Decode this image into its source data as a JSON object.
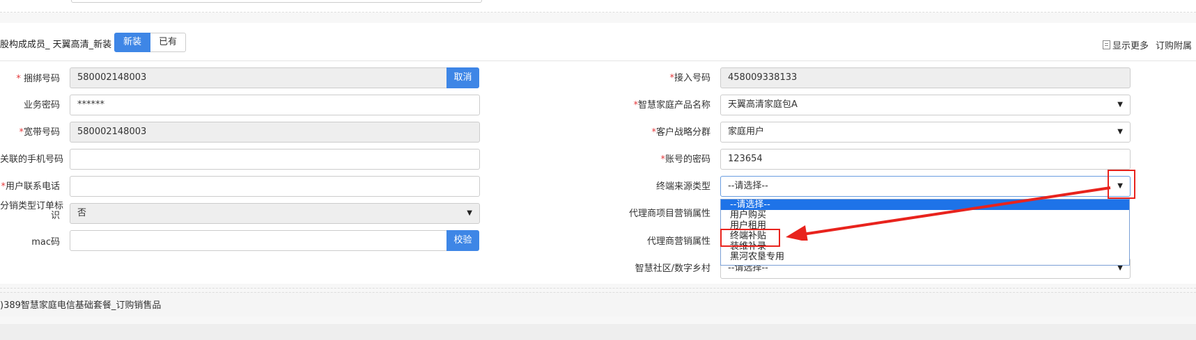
{
  "section": {
    "title": "股构成成员_ 天翼高清_新装",
    "toggle_new": "新装",
    "toggle_existing": "已有",
    "show_more": "显示更多",
    "order_attach": "订购附属"
  },
  "left_fields": {
    "bind_number": {
      "label": "捆绑号码",
      "value": "580002148003",
      "button": "取消"
    },
    "business_password": {
      "label": "业务密码",
      "value": "******"
    },
    "broadband_number": {
      "label": "宽带号码",
      "value": "580002148003"
    },
    "linked_phone": {
      "label": "关联的手机号码",
      "value": ""
    },
    "user_contact_phone": {
      "label": "用户联系电话",
      "value": ""
    },
    "distribution_order_flag": {
      "label_line1": "分销类型订单标",
      "label_line2": "识",
      "value": "否"
    },
    "mac": {
      "label": "mac码",
      "value": "",
      "button": "校验"
    }
  },
  "right_fields": {
    "access_number": {
      "label": "接入号码",
      "value": "458009338133"
    },
    "smart_home_product": {
      "label": "智慧家庭产品名称",
      "value": "天翼高清家庭包A"
    },
    "customer_strategy": {
      "label": "客户战略分群",
      "value": "家庭用户"
    },
    "account_password": {
      "label": "账号的密码",
      "value": "123654"
    },
    "terminal_source_type": {
      "label": "终端来源类型",
      "value": "--请选择--"
    },
    "agent_project_attr": {
      "label": "代理商项目营销属性"
    },
    "agent_marketing_attr": {
      "label": "代理商营销属性"
    },
    "smart_community": {
      "label": "智慧社区/数字乡村",
      "value": "--请选择--"
    }
  },
  "dropdown_options": [
    "--请选择--",
    "用户购买",
    "用户租用",
    "终端补贴",
    "装维补录",
    "黑河农垦专用"
  ],
  "footer": {
    "text": ")389智慧家庭电信基础套餐_订购销售品"
  },
  "colors": {
    "accent": "#3e86e6",
    "highlight": "#e8231d",
    "selected_option": "#1e73e8"
  }
}
